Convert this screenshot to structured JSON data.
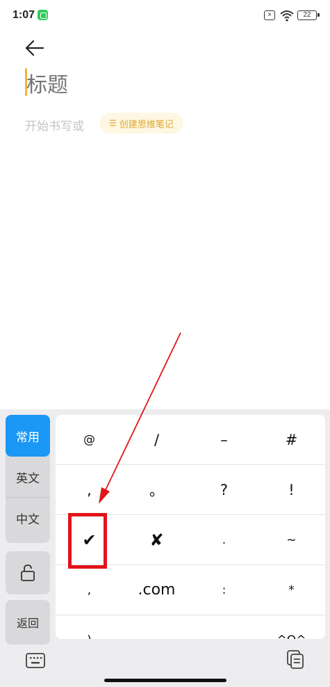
{
  "status_bar": {
    "time": "1:07",
    "battery": "22"
  },
  "editor": {
    "title_placeholder": "标题",
    "body_placeholder": "开始书写或",
    "mindmap_button_label": "创建思维笔记"
  },
  "keyboard": {
    "sidebar": {
      "tabs": [
        {
          "label": "常用",
          "active": true
        },
        {
          "label": "英文",
          "active": false
        },
        {
          "label": "中文",
          "active": false
        }
      ],
      "return_label": "返回"
    },
    "rows": [
      [
        "@",
        "/",
        "–",
        "#"
      ],
      [
        ",",
        "。",
        "?",
        "!"
      ],
      [
        "✔",
        "✘",
        ".",
        "~"
      ],
      [
        ",",
        ".com",
        ":",
        "*"
      ],
      [
        ")",
        ".",
        "·",
        "^O^"
      ]
    ]
  },
  "colors": {
    "accent_blue": "#1b97f5",
    "accent_yellow": "#e0a82e",
    "annotation_red": "#e1141b"
  }
}
